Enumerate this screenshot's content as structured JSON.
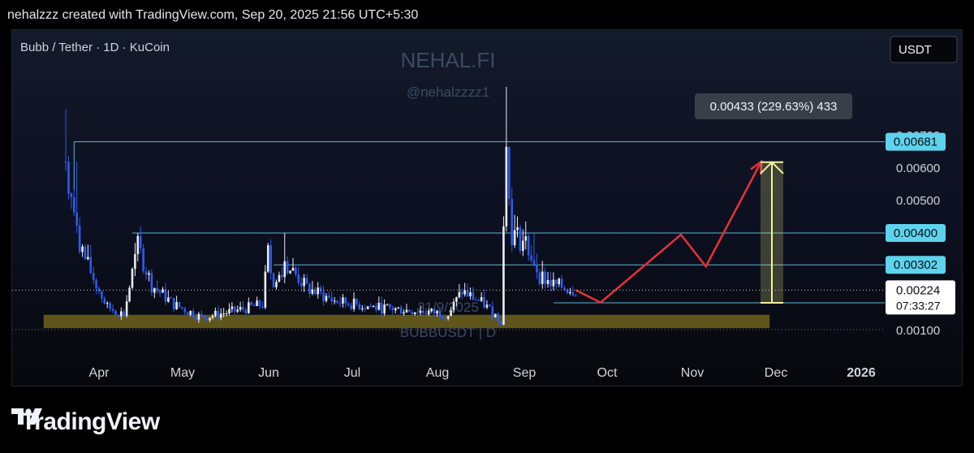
{
  "header": {
    "caption": "nehalzzz created with TradingView.com, Sep 20, 2025 21:56 UTC+5:30"
  },
  "chart_data": {
    "type": "candlestick",
    "symbol_line": "Bubb / Tether · 1D · KuCoin",
    "watermark_title": "NEHAL.FI",
    "watermark_handle": "@nehalzzzz1",
    "watermark_ticker": "BUBBUSDT | D",
    "watermark_date": "21/9/2025",
    "currency_button": "USDT",
    "x_ticks": [
      "Apr",
      "May",
      "Jun",
      "Jul",
      "Aug",
      "Sep",
      "Oct",
      "Nov",
      "Dec",
      "2026"
    ],
    "y_ticks": [
      0.001,
      0.005,
      0.006,
      0.007
    ],
    "y_tick_labels": [
      "0.00100",
      "0.00500",
      "0.00600",
      "0.00700"
    ],
    "ylim": [
      0.0008,
      0.0076
    ],
    "price_levels": [
      {
        "label": "0.00681",
        "value": 0.00681,
        "from": "2025-03-23"
      },
      {
        "label": "0.00400",
        "value": 0.004,
        "from": "2025-04-13"
      },
      {
        "label": "0.00302",
        "value": 0.00302,
        "from": "2025-06-03"
      },
      {
        "label": "0.00185",
        "value": 0.00185,
        "from": "2025-09-12"
      }
    ],
    "current_price": {
      "label": "0.00224",
      "value": 0.00224,
      "countdown": "07:33:27"
    },
    "measure": {
      "label": "0.00433 (229.63%) 433",
      "from": 0.00185,
      "to": 0.00618
    },
    "support_zone": {
      "low": 0.00107,
      "high": 0.00148,
      "start": "2025-03-12",
      "end": "2025-11-29"
    },
    "projection_path": [
      [
        "2025-09-20",
        0.00224
      ],
      [
        "2025-09-29",
        0.00186
      ],
      [
        "2025-10-28",
        0.00395
      ],
      [
        "2025-11-06",
        0.00297
      ],
      [
        "2025-11-26",
        0.0062
      ]
    ],
    "candles_daily_close_approx": [
      [
        "2025-03-20",
        0.0062
      ],
      [
        "2025-03-22",
        0.0051
      ],
      [
        "2025-03-24",
        0.004
      ],
      [
        "2025-03-27",
        0.0032
      ],
      [
        "2025-03-31",
        0.0024
      ],
      [
        "2025-04-04",
        0.0017
      ],
      [
        "2025-04-10",
        0.0015
      ],
      [
        "2025-04-15",
        0.0036
      ],
      [
        "2025-04-20",
        0.0024
      ],
      [
        "2025-04-28",
        0.0018
      ],
      [
        "2025-05-08",
        0.0014
      ],
      [
        "2025-05-20",
        0.0016
      ],
      [
        "2025-05-30",
        0.0018
      ],
      [
        "2025-06-01",
        0.0034
      ],
      [
        "2025-06-03",
        0.0023
      ],
      [
        "2025-06-07",
        0.0031
      ],
      [
        "2025-06-15",
        0.0023
      ],
      [
        "2025-06-25",
        0.0019
      ],
      [
        "2025-07-10",
        0.0017
      ],
      [
        "2025-07-25",
        0.0016
      ],
      [
        "2025-08-05",
        0.0015
      ],
      [
        "2025-08-10",
        0.0022
      ],
      [
        "2025-08-18",
        0.0018
      ],
      [
        "2025-08-24",
        0.0013
      ],
      [
        "2025-08-26",
        0.007
      ],
      [
        "2025-08-28",
        0.004
      ],
      [
        "2025-09-02",
        0.0037
      ],
      [
        "2025-09-07",
        0.0027
      ],
      [
        "2025-09-12",
        0.0024
      ],
      [
        "2025-09-20",
        0.00224
      ]
    ]
  },
  "footer": {
    "brand": "TradingView"
  }
}
